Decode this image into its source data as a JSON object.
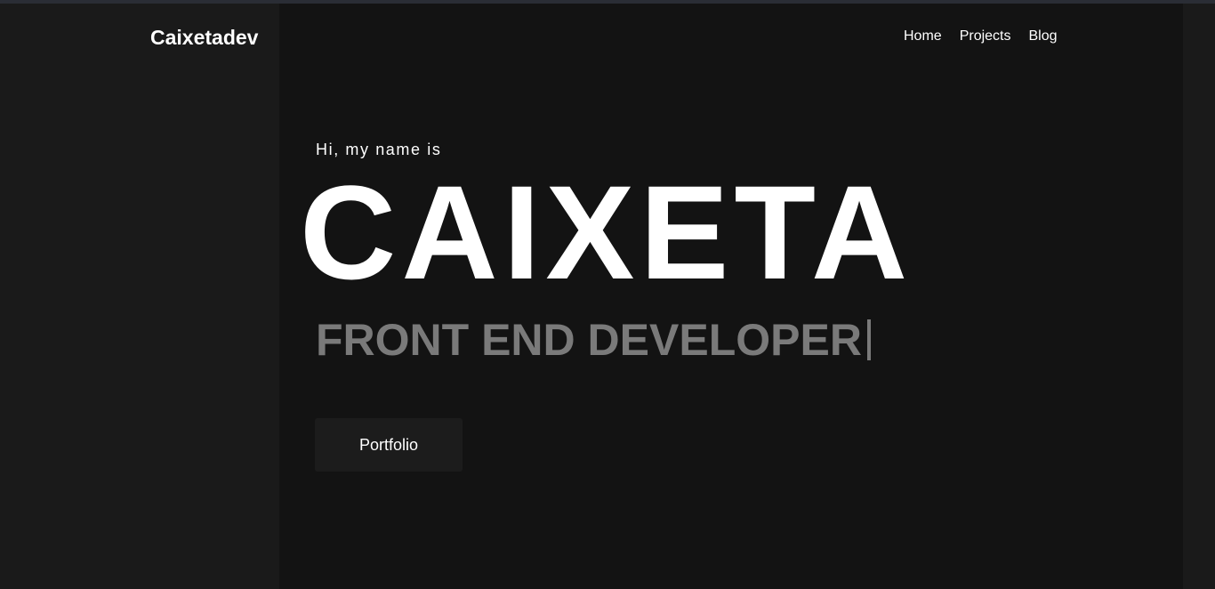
{
  "header": {
    "brand": "Caixetadev",
    "nav": [
      {
        "label": "Home"
      },
      {
        "label": "Projects"
      },
      {
        "label": "Blog"
      }
    ]
  },
  "hero": {
    "greeting": "Hi, my name is",
    "name": "CAIXETA",
    "role": "FRONT END DEVELOPER",
    "cta_label": "Portfolio"
  },
  "colors": {
    "background": "#131313",
    "side_panel": "#1a1a1a",
    "text_primary": "#ffffff",
    "text_muted": "#7a7a7a",
    "button_bg": "#1c1c1c"
  }
}
